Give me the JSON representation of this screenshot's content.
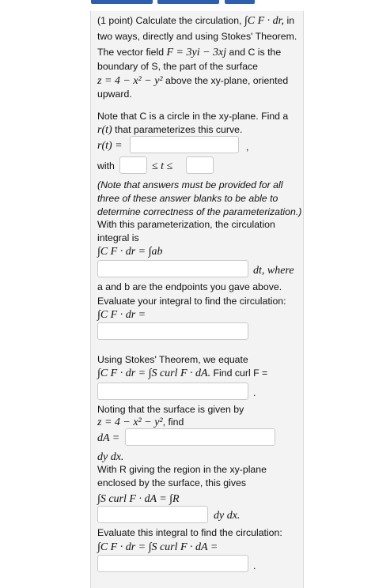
{
  "header": {
    "tabs": [
      "",
      "",
      ""
    ]
  },
  "problem": {
    "intro_line1": "(1 point) Calculate the circulation,",
    "intro_formula1": "∫C F · dr,",
    "intro_in": " in",
    "intro_line2": "two ways, directly and using Stokes' Theorem.",
    "field_line_a": "The vector field ",
    "field_formula": "F = 3yi − 3xj",
    "field_line_b": " and C is the",
    "boundary_line": "boundary of S, the part of the surface",
    "surface_formula": "z = 4 − x² − y²",
    "surface_line_b": " above the xy-plane, oriented",
    "upward": "upward.",
    "note_line1": "Note that C is a circle in the xy-plane. Find a",
    "note_line2_formula": "r(t)",
    "note_line2": " that parameterizes this curve.",
    "r_label": "r(t) =",
    "comma": ",",
    "with_label": "with",
    "leq_label": "≤ t ≤",
    "note_italic1": "(Note that answers must be provided for all",
    "note_italic2": "three of these answer blanks to be able to",
    "note_italic3": "determine correctness of the parameterization.)",
    "with_param1": "With this parameterization, the circulation",
    "with_param2": "integral is",
    "integral_formula1": "∫C F · dr = ∫ab",
    "dt_where": "dt, where",
    "ab_line": "a and b are the endpoints you gave above.",
    "evaluate1": "Evaluate your integral to find the circulation:",
    "integral_formula2": "∫C F · dr =",
    "stokes_line": "Using Stokes' Theorem, we equate",
    "stokes_formula": "∫C F · dr = ∫S curl F · dA.",
    "find_curl": " Find curl F =",
    "period1": ".",
    "noting_line": "Noting that the surface is given by",
    "surface_formula2": "z = 4 − x² − y²",
    "find_label": ", find",
    "dA_label": "dA =",
    "dydx1": "dy dx.",
    "region_line1": "With R giving the region in the xy-plane",
    "region_line2": "enclosed by the surface, this gives",
    "curl_formula": "∫S curl F · dA = ∫R",
    "dydx2": "dy dx.",
    "evaluate2": "Evaluate this integral to find the circulation:",
    "final_formula": "∫C F · dr = ∫S curl F · dA =",
    "period2": "."
  },
  "inputs": {
    "r_t": "",
    "t_lower": "",
    "t_upper": "",
    "integrand": "",
    "circulation_direct": "",
    "curl_F": "",
    "dA": "",
    "curl_integrand": "",
    "circulation_stokes": ""
  }
}
